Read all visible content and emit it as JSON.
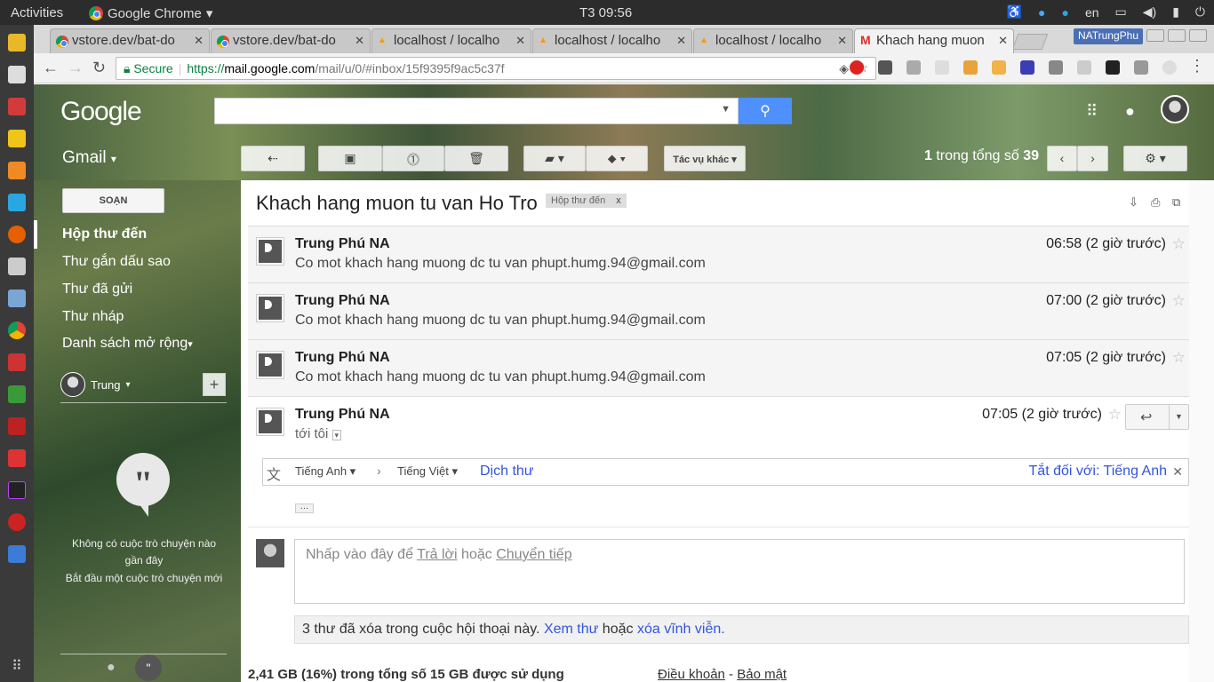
{
  "system": {
    "activities": "Activities",
    "app_name": "Google Chrome",
    "clock": "T3 09:56",
    "lang": "en"
  },
  "browser": {
    "tabs": [
      {
        "title": "vstore.dev/bat-do"
      },
      {
        "title": "vstore.dev/bat-do"
      },
      {
        "title": "localhost / localho"
      },
      {
        "title": "localhost / localho"
      },
      {
        "title": "localhost / localho"
      },
      {
        "title": "Khach hang muon"
      }
    ],
    "profile": "NATrungPhu",
    "url": {
      "secure": "Secure",
      "protocol": "https://",
      "host": "mail.google.com",
      "path": "/mail/u/0/#inbox/15f9395f9ac5c37f"
    }
  },
  "gmail": {
    "logo": "Google",
    "app_label": "Gmail",
    "toolbar": {
      "more": "Tác vụ khác"
    },
    "pager": {
      "current": "1",
      "middle": "trong tổng số",
      "total": "39"
    },
    "compose": "SOẠN",
    "nav": [
      {
        "label": "Hộp thư đến"
      },
      {
        "label": "Thư gắn dấu sao"
      },
      {
        "label": "Thư đã gửi"
      },
      {
        "label": "Thư nháp"
      },
      {
        "label": "Danh sách mở rộng"
      }
    ],
    "hangouts": {
      "user": "Trung",
      "empty1": "Không có cuộc trò chuyện nào gần đây",
      "empty2": "Bắt đầu một cuộc trò chuyện mới"
    },
    "thread": {
      "subject": "Khach hang muon tu van Ho Tro",
      "label": "Hộp thư đến",
      "label_close": "x",
      "messages": [
        {
          "sender": "Trung Phú NA",
          "snippet": "Co mot khach hang muong dc tu van phupt.humg.94@gmail.com",
          "time": "06:58 (2 giờ trước)"
        },
        {
          "sender": "Trung Phú NA",
          "snippet": "Co mot khach hang muong dc tu van phupt.humg.94@gmail.com",
          "time": "07:00 (2 giờ trước)"
        },
        {
          "sender": "Trung Phú NA",
          "snippet": "Co mot khach hang muong dc tu van phupt.humg.94@gmail.com",
          "time": "07:05 (2 giờ trước)"
        }
      ],
      "open": {
        "sender": "Trung Phú NA",
        "to": "tới tôi",
        "time": "07:05 (2 giờ trước)"
      },
      "translate": {
        "from": "Tiếng Anh",
        "to": "Tiếng Việt",
        "action": "Dịch thư",
        "off": "Tắt đối với: Tiếng Anh"
      },
      "reply": {
        "prefix": "Nhấp vào đây để",
        "reply": "Trả lời",
        "or": "hoặc",
        "forward": "Chuyển tiếp"
      },
      "deleted": {
        "text": "3 thư đã xóa trong cuộc hội thoại này.",
        "view": "Xem thư",
        "or": "hoặc",
        "purge": "xóa vĩnh viễn",
        "end": "."
      }
    },
    "footer": {
      "storage": "2,41 GB (16%) trong tổng số 15 GB được sử dụng",
      "terms": "Điều khoản",
      "privacy": "Bảo mật"
    }
  }
}
